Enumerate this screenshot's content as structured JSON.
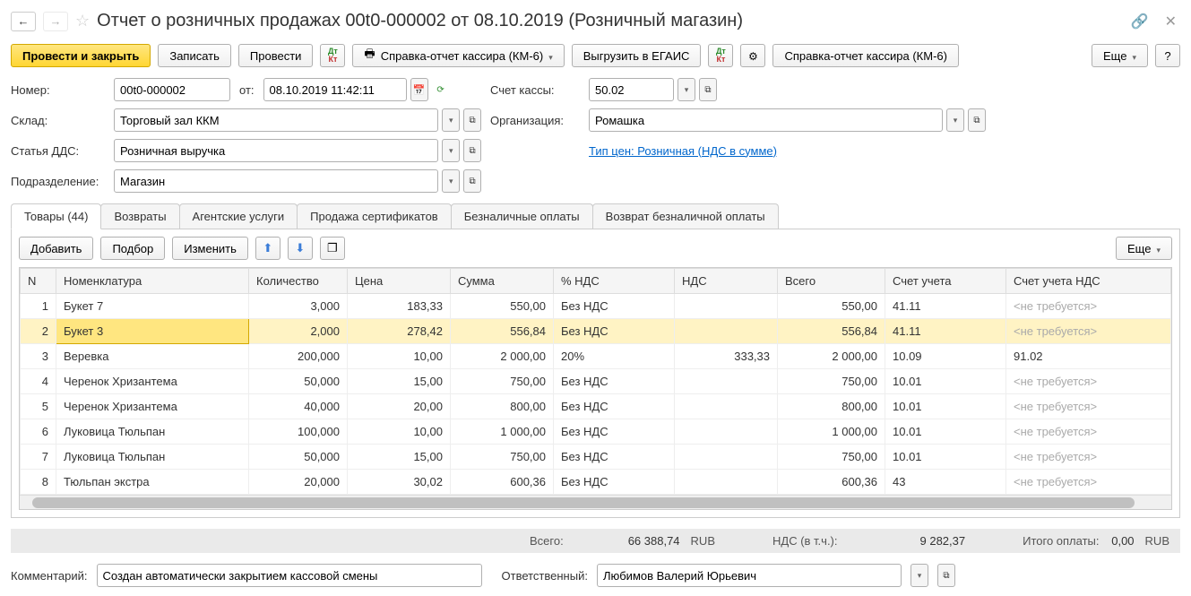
{
  "title": "Отчет о розничных продажах 00t0-000002 от 08.10.2019 (Розничный магазин)",
  "toolbar": {
    "post_close": "Провести и закрыть",
    "save": "Записать",
    "post": "Провести",
    "km6": "Справка-отчет кассира (КМ-6)",
    "egais": "Выгрузить в ЕГАИС",
    "km6_2": "Справка-отчет кассира (КМ-6)",
    "more": "Еще",
    "help": "?"
  },
  "form": {
    "number_label": "Номер:",
    "number_value": "00t0-000002",
    "from_label": "от:",
    "date_value": "08.10.2019 11:42:11",
    "cash_account_label": "Счет кассы:",
    "cash_account_value": "50.02",
    "warehouse_label": "Склад:",
    "warehouse_value": "Торговый зал ККМ",
    "org_label": "Организация:",
    "org_value": "Ромашка",
    "dds_label": "Статья ДДС:",
    "dds_value": "Розничная выручка",
    "price_type_link": "Тип цен: Розничная (НДС в сумме)",
    "division_label": "Подразделение:",
    "division_value": "Магазин"
  },
  "tabs": {
    "goods": "Товары (44)",
    "returns": "Возвраты",
    "agent": "Агентские услуги",
    "certs": "Продажа сертификатов",
    "cashless": "Безналичные оплаты",
    "cashless_return": "Возврат безналичной оплаты"
  },
  "table_toolbar": {
    "add": "Добавить",
    "pick": "Подбор",
    "edit": "Изменить",
    "more": "Еще"
  },
  "columns": {
    "n": "N",
    "nomenclature": "Номенклатура",
    "qty": "Количество",
    "price": "Цена",
    "sum": "Сумма",
    "vat_pct": "% НДС",
    "vat": "НДС",
    "total": "Всего",
    "account": "Счет учета",
    "vat_account": "Счет учета НДС"
  },
  "placeholder_not_required": "<не требуется>",
  "rows": [
    {
      "n": "1",
      "name": "Букет 7",
      "qty": "3,000",
      "price": "183,33",
      "sum": "550,00",
      "vat_pct": "Без НДС",
      "vat": "",
      "total": "550,00",
      "acc": "41.11",
      "vat_acc": ""
    },
    {
      "n": "2",
      "name": "Букет 3",
      "qty": "2,000",
      "price": "278,42",
      "sum": "556,84",
      "vat_pct": "Без НДС",
      "vat": "",
      "total": "556,84",
      "acc": "41.11",
      "vat_acc": "",
      "selected": true
    },
    {
      "n": "3",
      "name": "Веревка",
      "qty": "200,000",
      "price": "10,00",
      "sum": "2 000,00",
      "vat_pct": "20%",
      "vat": "333,33",
      "total": "2 000,00",
      "acc": "10.09",
      "vat_acc": "91.02"
    },
    {
      "n": "4",
      "name": "Черенок Хризантема",
      "qty": "50,000",
      "price": "15,00",
      "sum": "750,00",
      "vat_pct": "Без НДС",
      "vat": "",
      "total": "750,00",
      "acc": "10.01",
      "vat_acc": ""
    },
    {
      "n": "5",
      "name": "Черенок Хризантема",
      "qty": "40,000",
      "price": "20,00",
      "sum": "800,00",
      "vat_pct": "Без НДС",
      "vat": "",
      "total": "800,00",
      "acc": "10.01",
      "vat_acc": ""
    },
    {
      "n": "6",
      "name": "Луковица Тюльпан",
      "qty": "100,000",
      "price": "10,00",
      "sum": "1 000,00",
      "vat_pct": "Без НДС",
      "vat": "",
      "total": "1 000,00",
      "acc": "10.01",
      "vat_acc": ""
    },
    {
      "n": "7",
      "name": "Луковица Тюльпан",
      "qty": "50,000",
      "price": "15,00",
      "sum": "750,00",
      "vat_pct": "Без НДС",
      "vat": "",
      "total": "750,00",
      "acc": "10.01",
      "vat_acc": ""
    },
    {
      "n": "8",
      "name": "Тюльпан экстра",
      "qty": "20,000",
      "price": "30,02",
      "sum": "600,36",
      "vat_pct": "Без НДС",
      "vat": "",
      "total": "600,36",
      "acc": "43",
      "vat_acc": ""
    }
  ],
  "totals": {
    "total_label": "Всего:",
    "total_value": "66 388,74",
    "currency": "RUB",
    "vat_label": "НДС (в т.ч.):",
    "vat_value": "9 282,37",
    "paid_label": "Итого оплаты:",
    "paid_value": "0,00"
  },
  "bottom": {
    "comment_label": "Комментарий:",
    "comment_value": "Создан автоматически закрытием кассовой смены",
    "responsible_label": "Ответственный:",
    "responsible_value": "Любимов Валерий Юрьевич"
  }
}
